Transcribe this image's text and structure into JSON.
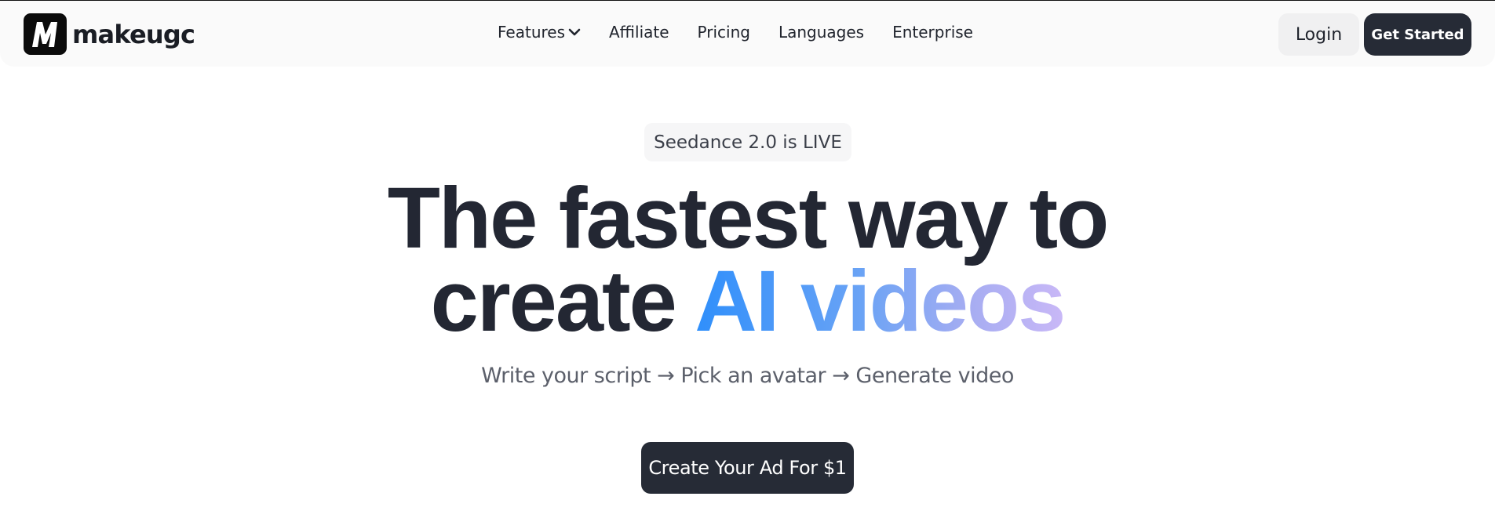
{
  "header": {
    "logo_icon": "m-logo-icon",
    "logo_text": "makeugc",
    "nav": [
      {
        "label": "Features",
        "icon": "chevron-down-icon"
      },
      {
        "label": "Affiliate"
      },
      {
        "label": "Pricing"
      },
      {
        "label": "Languages"
      },
      {
        "label": "Enterprise"
      }
    ],
    "login_label": "Login",
    "get_started_label": "Get Started"
  },
  "hero": {
    "badge": "Seedance 2.0 is LIVE",
    "headline_line1": "The fastest way to",
    "headline_line2_plain": "create ",
    "headline_line2_highlight": "AI videos",
    "subtitle": "Write your script → Pick an avatar → Generate video",
    "cta_label": "Create Your Ad For $1"
  },
  "colors": {
    "primary_dark": "#262b36",
    "text_dark": "#232733",
    "gradient_start": "#2f8ffb",
    "gradient_end": "#c9b8f7",
    "nav_background": "#fafafa",
    "login_background": "#f0f0f1"
  }
}
